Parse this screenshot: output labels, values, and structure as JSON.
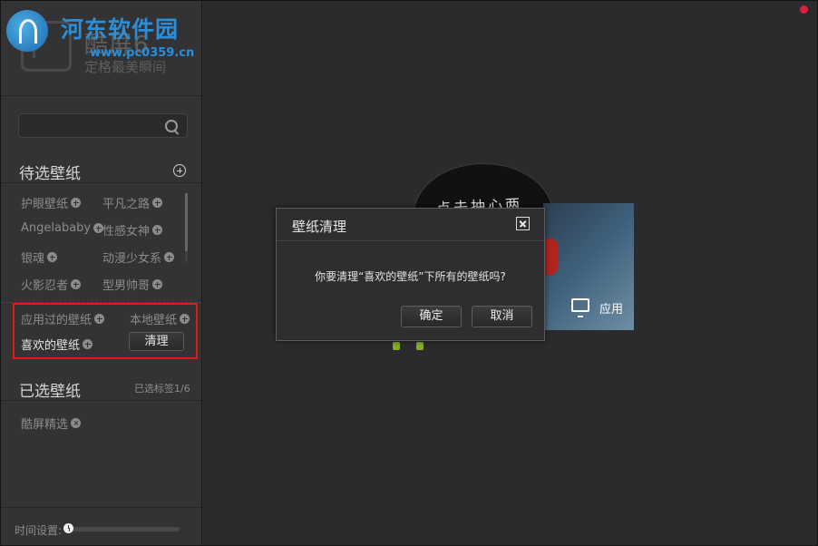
{
  "watermark": {
    "site": "河东软件园",
    "url": "www.pc0359.cn"
  },
  "app": {
    "name": "酷屏6",
    "slogan": "定格最美瞬间"
  },
  "search": {
    "value": "",
    "placeholder": ""
  },
  "pending": {
    "title": "待选壁纸",
    "tags": [
      {
        "label": "护眼壁纸"
      },
      {
        "label": "平凡之路"
      },
      {
        "label": "Angelababy"
      },
      {
        "label": "性感女神"
      },
      {
        "label": "银魂"
      },
      {
        "label": "动漫少女系"
      },
      {
        "label": "火影忍者"
      },
      {
        "label": "型男帅哥"
      }
    ],
    "special_tags": [
      {
        "label": "应用过的壁纸"
      },
      {
        "label": "本地壁纸"
      },
      {
        "label": "喜欢的壁纸"
      }
    ],
    "clear_label": "清理"
  },
  "selected": {
    "title": "已选壁纸",
    "count_text": "已选标签1/6",
    "tags": [
      {
        "label": "酷屏精选"
      }
    ]
  },
  "footer": {
    "time_label": "时间设置:",
    "time_level": 0.0
  },
  "preview": {
    "text": "点去抽心两",
    "apply_label": "应用"
  },
  "dialog": {
    "title": "壁纸清理",
    "message": "你要清理“喜欢的壁纸”下所有的壁纸吗?",
    "confirm_label": "确定",
    "cancel_label": "取消"
  },
  "colors": {
    "highlight": "#e01a1a",
    "close_dot": "#d9223a",
    "watermark": "#2a8ed8"
  }
}
